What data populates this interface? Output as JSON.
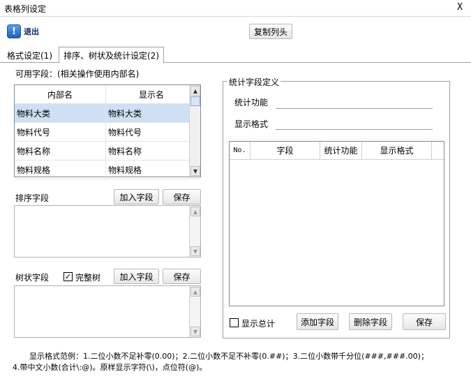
{
  "window": {
    "title": "表格列设定",
    "close_label": "X"
  },
  "toolbar": {
    "exit_label": "退出",
    "copy_header_label": "复制列头"
  },
  "tabs": [
    {
      "label": "格式设定(1)"
    },
    {
      "label": "排序、树状及统计设定(2)"
    }
  ],
  "available_fields": {
    "label": "可用字段：(相关操作使用内部名)",
    "columns": [
      "内部名",
      "显示名"
    ],
    "rows": [
      [
        "物料大类",
        "物料大类"
      ],
      [
        "物料代号",
        "物料代号"
      ],
      [
        "物料名称",
        "物料名称"
      ],
      [
        "物料规格",
        "物料规格"
      ]
    ],
    "selected_index": 0
  },
  "sort_section": {
    "label": "排序字段",
    "add_label": "加入字段",
    "save_label": "保存"
  },
  "tree_section": {
    "label": "树状字段",
    "complete_tree_label": "完整树",
    "complete_tree_checked": true,
    "add_label": "加入字段",
    "save_label": "保存"
  },
  "stat_section": {
    "legend": "统计字段定义",
    "function_label": "统计功能",
    "format_label": "显示格式",
    "columns": [
      "No.",
      "字段",
      "统计功能",
      "显示格式"
    ],
    "show_total_label": "显示总计",
    "show_total_checked": false,
    "add_label": "添加字段",
    "delete_label": "删除字段",
    "save_label": "保存"
  },
  "footer": {
    "line1": "显示格式范例：1.二位小数不足补零(0.00)；2.二位小数不足不补零(0.##)；3.二位小数带千分位(###,###.00)；",
    "line2": "4.带中文小数(合计\\:@)。原样显示字符(\\)，点位符(@)。"
  }
}
